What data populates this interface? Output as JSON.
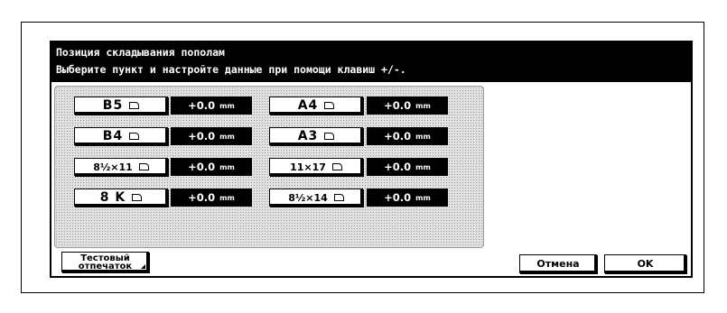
{
  "dialog": {
    "title": "Позиция складывания пополам",
    "instruction": "Выберите пункт и настройте данные при помощи клавиш +/-."
  },
  "paper_sizes": [
    {
      "label": "B5",
      "value": "+0.0",
      "unit": "mm"
    },
    {
      "label": "A4",
      "value": "+0.0",
      "unit": "mm"
    },
    {
      "label": "B4",
      "value": "+0.0",
      "unit": "mm"
    },
    {
      "label": "A3",
      "value": "+0.0",
      "unit": "mm"
    },
    {
      "label": "8½×11",
      "value": "+0.0",
      "unit": "mm"
    },
    {
      "label": "11×17",
      "value": "+0.0",
      "unit": "mm"
    },
    {
      "label": "8 K",
      "value": "+0.0",
      "unit": "mm"
    },
    {
      "label": "8½×14",
      "value": "+0.0",
      "unit": "mm"
    }
  ],
  "buttons": {
    "test_print_line1": "Тестовый",
    "test_print_line2": "отпечаток",
    "cancel": "Отмена",
    "ok": "OK"
  },
  "icons": {
    "paper_orientation": "paper-landscape-icon"
  }
}
